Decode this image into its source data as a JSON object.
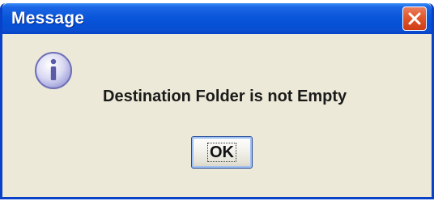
{
  "window": {
    "title": "Message",
    "close_icon": "close-icon"
  },
  "content": {
    "icon": "information-icon",
    "message": "Destination Folder is not Empty"
  },
  "buttons": {
    "ok_label": "OK"
  },
  "colors": {
    "titlebar_blue": "#0a56da",
    "close_red": "#e1572b",
    "dialog_background": "#ece9d8"
  }
}
